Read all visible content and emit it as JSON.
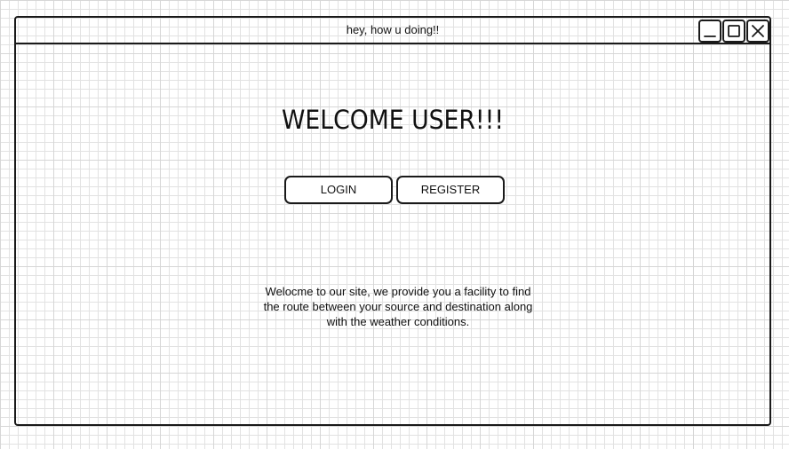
{
  "window": {
    "title": "hey, how u doing!!"
  },
  "main": {
    "heading": "WELCOME USER!!!",
    "login_label": "LOGIN",
    "register_label": "REGISTER",
    "description": "Welocme to our site, we provide you a facility to find the route between your source and destination along with the weather conditions."
  },
  "icons": {
    "minimize": "minimize-icon",
    "maximize": "maximize-icon",
    "close": "close-icon"
  }
}
